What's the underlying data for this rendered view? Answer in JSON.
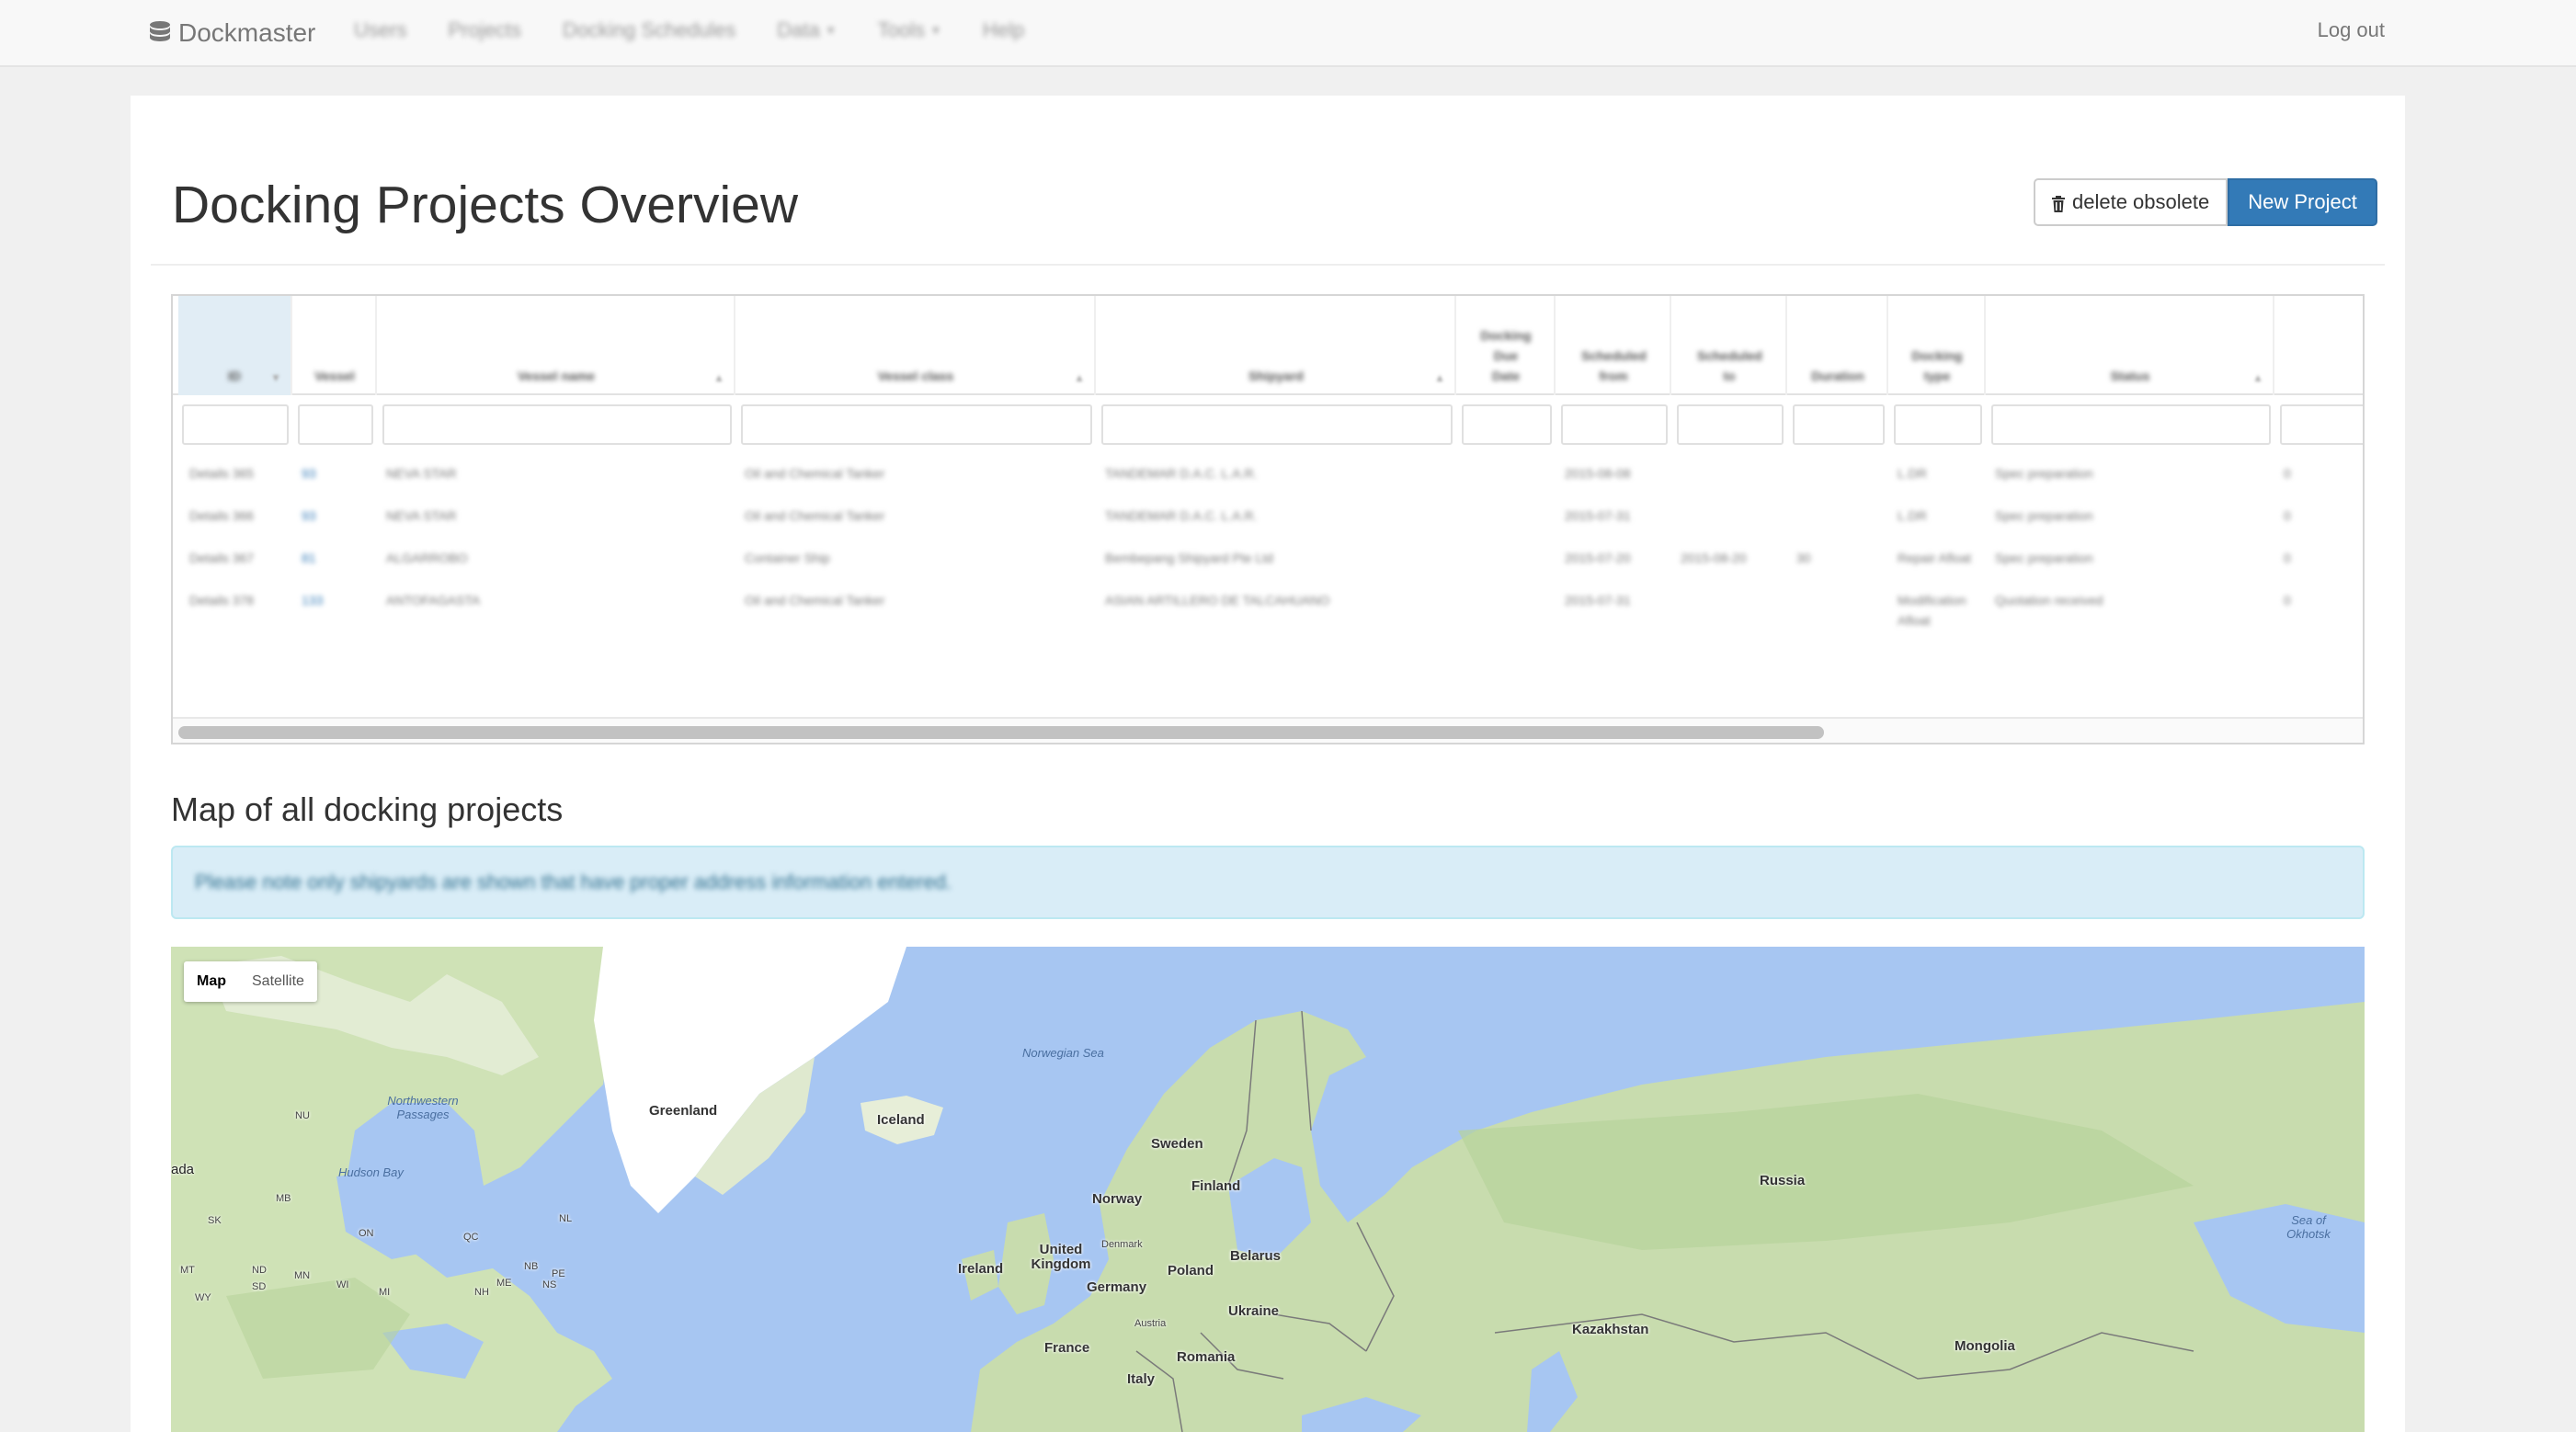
{
  "nav": {
    "brand": "Dockmaster",
    "links": [
      {
        "label": "Users",
        "dropdown": false
      },
      {
        "label": "Projects",
        "dropdown": false
      },
      {
        "label": "Docking Schedules",
        "dropdown": false
      },
      {
        "label": "Data",
        "dropdown": true
      },
      {
        "label": "Tools",
        "dropdown": true
      },
      {
        "label": "Help",
        "dropdown": false
      }
    ],
    "logout": "Log out"
  },
  "page": {
    "title": "Docking Projects Overview",
    "delete_button": "delete obsolete",
    "new_button": "New Project"
  },
  "table": {
    "columns": [
      "ID",
      "Vessel",
      "Vessel name",
      "Vessel class",
      "Shipyard",
      "Docking Due Date",
      "Scheduled from",
      "Scheduled to",
      "Duration",
      "Docking type",
      "Status",
      ""
    ],
    "rows": [
      {
        "id": "Details 365",
        "vessel": "93",
        "name": "NEVA STAR",
        "class": "Oil and Chemical Tanker",
        "yard": "TANDEMAR D.A.C. L.A.R.",
        "due": "",
        "from": "2015-08-08",
        "to": "",
        "duration": "",
        "type": "L.DR",
        "status": "Spec preparation",
        "extra": "0"
      },
      {
        "id": "Details 366",
        "vessel": "93",
        "name": "NEVA STAR",
        "class": "Oil and Chemical Tanker",
        "yard": "TANDEMAR D.A.C. L.A.R.",
        "due": "",
        "from": "2015-07-31",
        "to": "",
        "duration": "",
        "type": "L.DR",
        "status": "Spec preparation",
        "extra": "0"
      },
      {
        "id": "Details 367",
        "vessel": "81",
        "name": "ALGARROBO",
        "class": "Container Ship",
        "yard": "Bembepang Shipyard Pte Ltd",
        "due": "",
        "from": "2015-07-20",
        "to": "2015-08-20",
        "duration": "30",
        "type": "Repair Afloat",
        "status": "Spec preparation",
        "extra": "0"
      },
      {
        "id": "Details 378",
        "vessel": "133",
        "name": "ANTOFAGASTA",
        "class": "Oil and Chemical Tanker",
        "yard": "ASIAN ARTILLERO DE TALCAHUANO",
        "due": "",
        "from": "2015-07-31",
        "to": "",
        "duration": "",
        "type": "Modification Afloat",
        "status": "Quotation received",
        "extra": "0"
      }
    ]
  },
  "map_section": {
    "heading": "Map of all docking projects",
    "notice": "Please note only shipyards are shown that have proper address information entered.",
    "map_type": {
      "map": "Map",
      "satellite": "Satellite",
      "selected": "Map"
    },
    "labels": {
      "greenland": "Greenland",
      "iceland": "Iceland",
      "norwegian_sea": "Norwegian Sea",
      "northwestern_passages": "Northwestern Passages",
      "nu": "NU",
      "ada": "ada",
      "hudson_bay": "Hudson Bay",
      "mb": "MB",
      "sk": "SK",
      "on": "ON",
      "qc": "QC",
      "nl": "NL",
      "nd": "ND",
      "mn": "MN",
      "sd": "SD",
      "mt": "MT",
      "wi": "WI",
      "mi": "MI",
      "nb": "NB",
      "pe": "PE",
      "ns": "NS",
      "me": "ME",
      "nh": "NH",
      "wy": "WY",
      "sweden": "Sweden",
      "finland": "Finland",
      "norway": "Norway",
      "denmark": "Denmark",
      "united_kingdom": "United Kingdom",
      "ireland": "Ireland",
      "germany": "Germany",
      "poland": "Poland",
      "belarus": "Belarus",
      "ukraine": "Ukraine",
      "austria": "Austria",
      "france": "France",
      "romania": "Romania",
      "italy": "Italy",
      "russia": "Russia",
      "kazakhstan": "Kazakhstan",
      "mongolia": "Mongolia",
      "sea_of_okhotsk": "Sea of Okhotsk"
    },
    "colors": {
      "water": "#a7c6f2",
      "land": "#d8e7c4",
      "forest": "#b7d39b",
      "ice": "#ffffff"
    }
  }
}
